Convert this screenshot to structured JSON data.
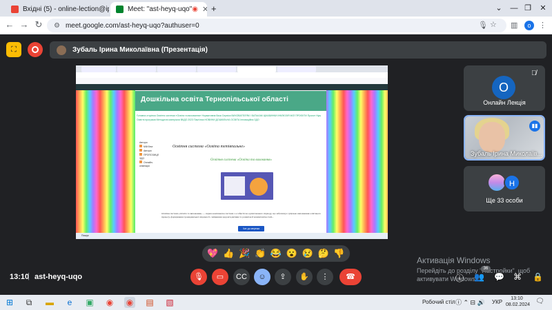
{
  "browser": {
    "tabs": [
      {
        "label": "Вхідні (5) - online-lection@ipp",
        "favicon_color": "#ea4335",
        "active": false
      },
      {
        "label": "Meet: \"ast-heyq-uqo\"",
        "favicon_color": "#00832d",
        "active": true
      }
    ],
    "new_tab": "+",
    "window_controls": {
      "collapse": "⌄",
      "minimize": "—",
      "restore": "❐",
      "close": "✕"
    },
    "address": "meet.google.com/ast-heyq-uqo?authuser=0",
    "profile_initial": "o"
  },
  "meet": {
    "presenter_label": "Зубаль Ірина Миколаївна (Презентація)",
    "time": "13:10",
    "meeting_code": "ast-heyq-uqo",
    "participants_count": "36",
    "tiles": [
      {
        "name": "Онлайн Лекція",
        "initial": "О"
      },
      {
        "name": "Зубаль Ірина Миколаїв..."
      },
      {
        "name": "Ще 33 особи",
        "initial": "Н"
      }
    ],
    "reactions": [
      "💖",
      "👍",
      "🎉",
      "👏",
      "😂",
      "😮",
      "😢",
      "🤔",
      "👎"
    ]
  },
  "shared": {
    "blog_title": "Дошкільна освіта Тернопільської області",
    "page_title": "Освітня система «Освіта тетівпальне»",
    "green_link": "Освітня система «Освіта та виховання»",
    "menu_text": "Головна сторінка  Освітня система «Освіта та виховання»  Нормативна база  Сервіси  ВИХОВАТЕЛЯМ І БАТЬКАМ  ЦІКАВИНКИ  ІНКЛЮЗІЯ  МОЇ ПРОЄКТИ  Проєкт Нуш  Освітні програми  Методичні матеріали  ВКДО 2023  Пам'ятки  НОВИНИ  ДОШКІЛЬНА ОСВІТА  Інноваційна  ЗДО",
    "sidebar_heading": "Автори",
    "sidebar_items": [
      "Мій блог",
      "Автори",
      "ПРОПОЗИЦІЇ ЗДО",
      "Онлайн-семінари"
    ],
    "body_text": "Освітня система «Освіта та виховання» — перша комплексна система з особистісно орієнтованого підходу, що забезпечує суцільне наповнення освітнього процесу, формування громадянської свідомості, зміцнення здоров'я дитини та розвиток її компетентностей...",
    "badge": "Чат до мережа",
    "search": "Пошук"
  },
  "os": {
    "watermark_title": "Активація Windows",
    "watermark_sub1": "Перейдіть до розділу \"Настройки\", щоб",
    "watermark_sub2": "активувати Windows.",
    "desktop": "Робочий стіл",
    "lang": "УКР",
    "clock_time": "13:10",
    "clock_date": "08.02.2024"
  }
}
